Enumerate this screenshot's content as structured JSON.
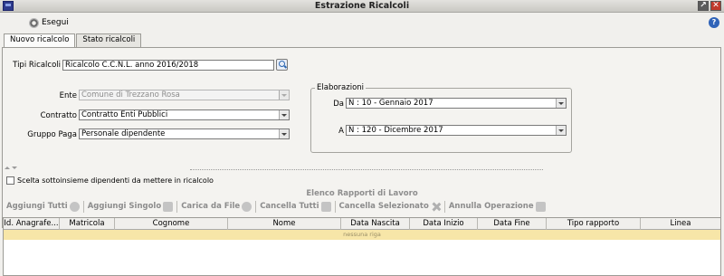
{
  "window": {
    "title": "Estrazione Ricalcoli"
  },
  "toolbar": {
    "esegui_label": "Esegui",
    "help": "?"
  },
  "titlebar_buttons": {
    "maximize": "↗",
    "close": "✕"
  },
  "tabs": [
    {
      "label": "Nuovo ricalcolo",
      "active": true
    },
    {
      "label": "Stato ricalcoli",
      "active": false
    }
  ],
  "form": {
    "tipi_ricalcoli": {
      "label": "Tipi Ricalcoli",
      "value": "Ricalcolo C.C.N.L. anno 2016/2018"
    },
    "ente": {
      "label": "Ente",
      "value": "Comune di Trezzano Rosa"
    },
    "contratto": {
      "label": "Contratto",
      "value": "Contratto Enti Pubblici"
    },
    "gruppo_paga": {
      "label": "Gruppo Paga",
      "value": "Personale dipendente"
    }
  },
  "elaborazioni": {
    "title": "Elaborazioni",
    "da": {
      "label": "Da",
      "value": "N : 10 - Gennaio 2017"
    },
    "a": {
      "label": "A",
      "value": "N : 120 - Dicembre  2017"
    }
  },
  "checkbox": {
    "label": "Scelta sottoinsieme dipendenti da mettere in ricalcolo",
    "checked": false
  },
  "list": {
    "title": "Elenco Rapporti di Lavoro",
    "actions": [
      {
        "label": "Aggiungi Tutti",
        "icon": "add-all-icon"
      },
      {
        "label": "Aggiungi Singolo",
        "icon": "add-single-icon"
      },
      {
        "label": "Carica da File",
        "icon": "upload-icon"
      },
      {
        "label": "Cancella Tutti",
        "icon": "delete-all-icon"
      },
      {
        "label": "Cancella Selezionato",
        "icon": "delete-icon"
      },
      {
        "label": "Annulla Operazione",
        "icon": "undo-icon"
      }
    ],
    "columns": [
      "Id. Anagrafe...",
      "Matricola",
      "Cognome",
      "Nome",
      "Data Nascita",
      "Data Inizio",
      "Data Fine",
      "Tipo rapporto",
      "Linea"
    ],
    "empty_text": "nessuna riga"
  }
}
